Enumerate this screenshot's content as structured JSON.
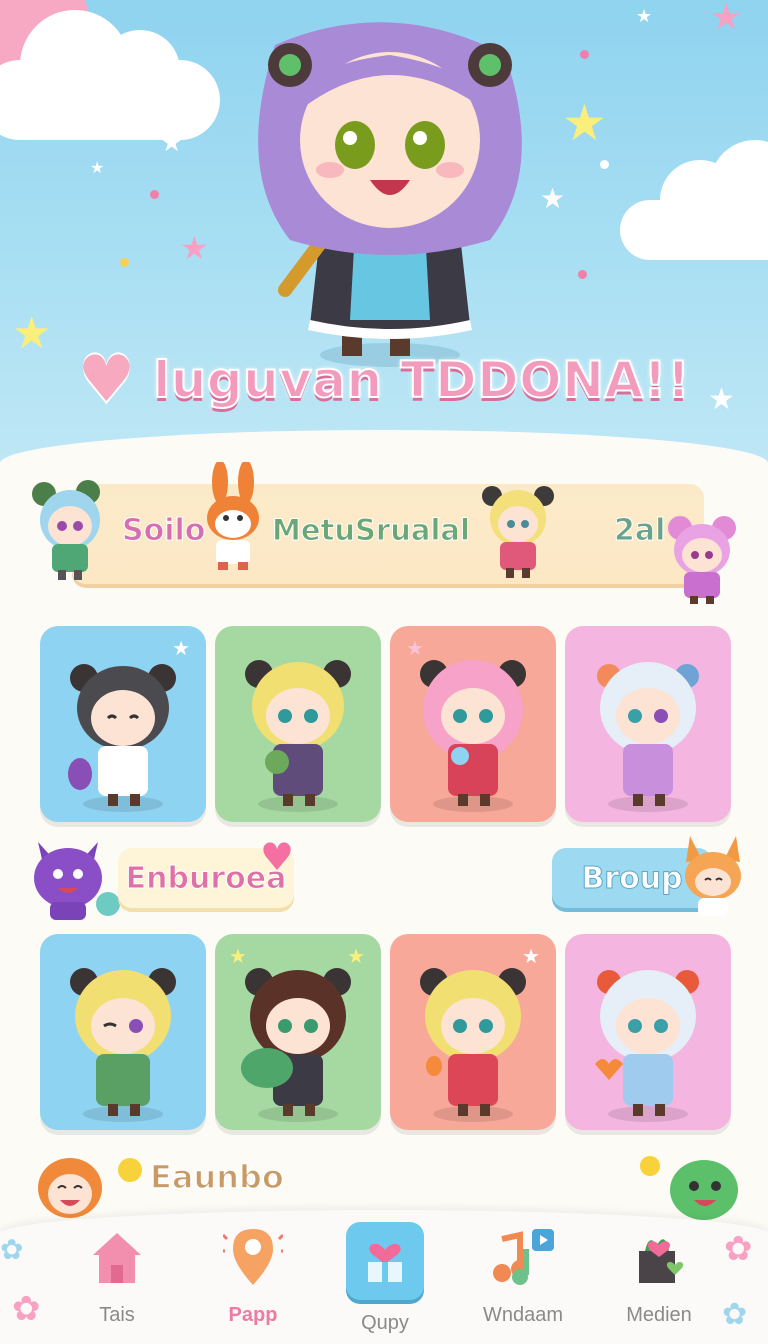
{
  "hero": {
    "title": "luguvan TDDONA!!"
  },
  "banner": {
    "label_left": "Soilo",
    "label_mid": "MetuSrualal",
    "label_right": "2al"
  },
  "section_pills": {
    "left": "Enburoea",
    "right": "Broup"
  },
  "section_bottom_title": "Eaunbo",
  "nav": {
    "items": [
      {
        "label": "Tais",
        "icon": "house-icon"
      },
      {
        "label": "Papp",
        "icon": "map-pin-icon"
      },
      {
        "label": "Qupy",
        "icon": "gift-icon"
      },
      {
        "label": "Wndaam",
        "icon": "music-icon"
      },
      {
        "label": "Medien",
        "icon": "plant-heart-icon"
      }
    ]
  },
  "colors": {
    "card_blue": "#8ed3f1",
    "card_green": "#a6d9a2",
    "card_coral": "#f7a898",
    "card_pink": "#f4b6e0",
    "pink_accent": "#f39bbd"
  }
}
